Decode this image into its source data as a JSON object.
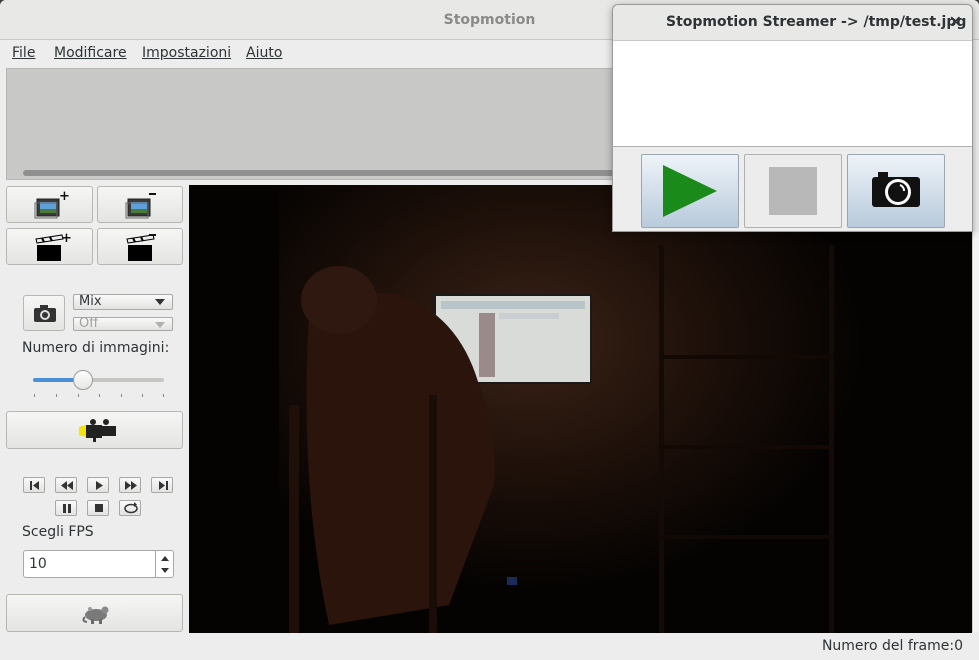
{
  "window": {
    "title": "Stopmotion"
  },
  "menu": [
    {
      "label": "File"
    },
    {
      "label": "Modificare"
    },
    {
      "label": "Impostazioni"
    },
    {
      "label": "Aiuto"
    }
  ],
  "capture": {
    "mix_mode": "Mix",
    "mix_option": "Off",
    "images_label": "Numero di immagini:",
    "images_value": 0.38
  },
  "playback": {
    "fps_label": "Scegli FPS",
    "fps_value": "10"
  },
  "status": {
    "frame_label": "Numero del frame:0"
  },
  "streamer": {
    "title": "Stopmotion Streamer -> /tmp/test.jpg",
    "close": "✕"
  },
  "colors": {
    "play_green": "#1a8a1a",
    "stop_gray": "#b8b8b8",
    "accent": "#4a90d9"
  }
}
